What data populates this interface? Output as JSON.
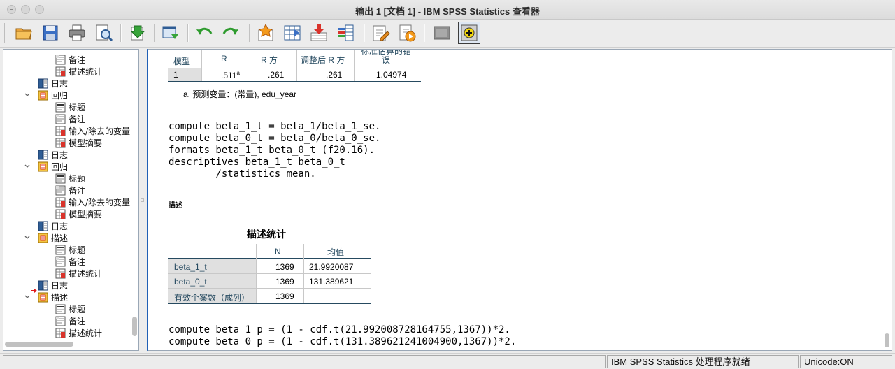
{
  "window": {
    "title": "输出 1 [文档 1] - IBM SPSS Statistics 查看器"
  },
  "toolbar": {
    "buttons": [
      {
        "icon": "open-folder-icon"
      },
      {
        "icon": "save-icon"
      },
      {
        "icon": "print-icon"
      },
      {
        "icon": "print-preview-icon"
      },
      {
        "icon": "export-icon"
      },
      {
        "icon": "recall-dialog-icon"
      },
      {
        "icon": "undo-icon"
      },
      {
        "icon": "redo-icon"
      },
      {
        "icon": "go-to-case-icon"
      },
      {
        "icon": "go-to-variable-icon"
      },
      {
        "icon": "insert-cases-icon"
      },
      {
        "icon": "variables-icon"
      },
      {
        "icon": "edit-output-icon"
      },
      {
        "icon": "run-script-icon"
      },
      {
        "icon": "disabled-icon"
      },
      {
        "icon": "designate-window-icon"
      }
    ]
  },
  "outline": {
    "items": [
      {
        "label": "备注",
        "icon": "note-icon",
        "level": 2
      },
      {
        "label": "描述统计",
        "icon": "table-icon",
        "level": 2
      },
      {
        "label": "日志",
        "icon": "log-book-icon",
        "level": 1
      },
      {
        "label": "回归",
        "icon": "procedure-icon",
        "level": 1,
        "expanded": true
      },
      {
        "label": "标题",
        "icon": "title-icon",
        "level": 2
      },
      {
        "label": "备注",
        "icon": "note-icon",
        "level": 2
      },
      {
        "label": "输入/除去的变量",
        "icon": "table-icon",
        "level": 2
      },
      {
        "label": "模型摘要",
        "icon": "table-icon",
        "level": 2
      },
      {
        "label": "日志",
        "icon": "log-book-icon",
        "level": 1
      },
      {
        "label": "回归",
        "icon": "procedure-icon",
        "level": 1,
        "expanded": true
      },
      {
        "label": "标题",
        "icon": "title-icon",
        "level": 2
      },
      {
        "label": "备注",
        "icon": "note-icon",
        "level": 2
      },
      {
        "label": "输入/除去的变量",
        "icon": "table-icon",
        "level": 2
      },
      {
        "label": "模型摘要",
        "icon": "table-icon",
        "level": 2
      },
      {
        "label": "日志",
        "icon": "log-book-icon",
        "level": 1
      },
      {
        "label": "描述",
        "icon": "procedure-icon",
        "level": 1,
        "expanded": true
      },
      {
        "label": "标题",
        "icon": "title-icon",
        "level": 2
      },
      {
        "label": "备注",
        "icon": "note-icon",
        "level": 2
      },
      {
        "label": "描述统计",
        "icon": "table-icon",
        "level": 2
      },
      {
        "label": "日志",
        "icon": "log-book-icon",
        "level": 1,
        "current": true
      },
      {
        "label": "描述",
        "icon": "procedure-icon",
        "level": 1,
        "expanded": true
      },
      {
        "label": "标题",
        "icon": "title-icon",
        "level": 2
      },
      {
        "label": "备注",
        "icon": "note-icon",
        "level": 2
      },
      {
        "label": "描述统计",
        "icon": "table-icon",
        "level": 2
      }
    ]
  },
  "model_summary": {
    "headers": [
      "模型",
      "R",
      "R 方",
      "调整后 R 方",
      "标准估算的错误"
    ],
    "header_last_line1": "标准估算的错",
    "header_last_line2": "误",
    "row": {
      "model": "1",
      "r": ".511",
      "r_sup": "a",
      "r2": ".261",
      "adj_r2": ".261",
      "se": "1.04974"
    },
    "note": "a. 预测变量：(常量), edu_year"
  },
  "syntax1": [
    "compute beta_1_t = beta_1/beta_1_se.",
    "compute beta_0_t = beta_0/beta_0_se.",
    "formats beta_1_t beta_0_t (f20.16).",
    "descriptives beta_1_t beta_0_t",
    "        /statistics mean."
  ],
  "section_label": "描述",
  "desc_stats": {
    "title": "描述统计",
    "headers": [
      "",
      "N",
      "均值"
    ],
    "rows": [
      {
        "label": "beta_1_t",
        "n": "1369",
        "mean": "21.9920087"
      },
      {
        "label": "beta_0_t",
        "n": "1369",
        "mean": "131.389621"
      },
      {
        "label": "有效个案数（成列）",
        "n": "1369",
        "mean": ""
      }
    ]
  },
  "syntax2": [
    "compute beta_1_p = (1 - cdf.t(21.992008728164755,1367))*2.",
    "compute beta_0_p = (1 - cdf.t(131.389621241004900,1367))*2."
  ],
  "status": {
    "processor": "IBM SPSS Statistics 处理程序就绪",
    "unicode": "Unicode:ON"
  }
}
